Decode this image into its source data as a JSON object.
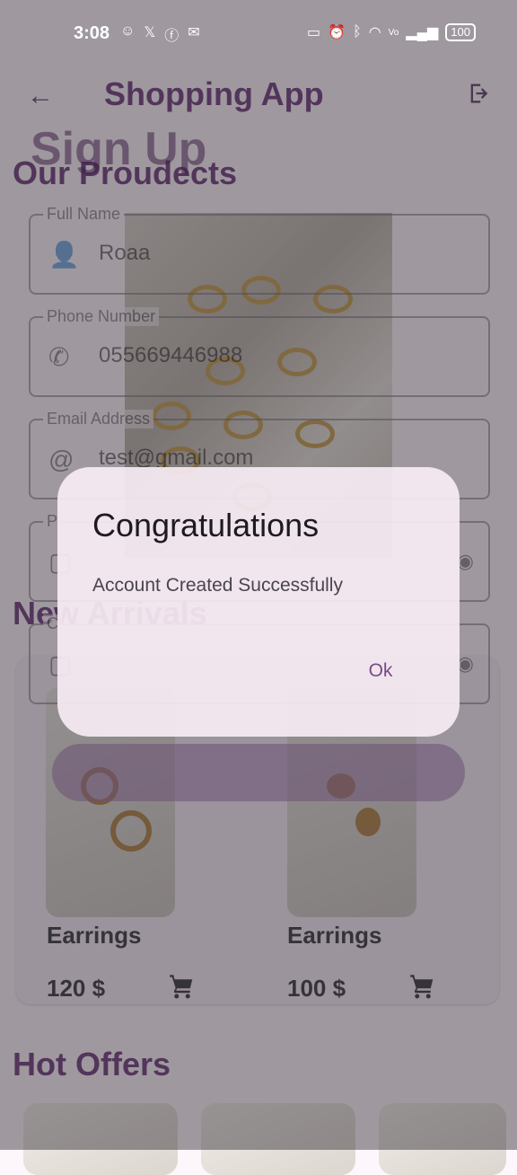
{
  "status_bar": {
    "time": "3:08",
    "battery": "100"
  },
  "app_bar": {
    "title": "Shopping App",
    "back_icon": "arrow-back-icon",
    "logout_icon": "logout-icon"
  },
  "products": {
    "section_our": "Our Proudects",
    "section_new": "New Arrivals",
    "section_hot": "Hot Offers",
    "items": [
      {
        "name": "Earrings",
        "price": "120 $"
      },
      {
        "name": "Earrings",
        "price": "100 $"
      }
    ]
  },
  "signup": {
    "title": "Sign Up",
    "fields": [
      {
        "label": "Full Name",
        "value": "Roaa",
        "icon": "person-icon"
      },
      {
        "label": "Phone Number",
        "value": "055669446988",
        "icon": "phone-icon"
      },
      {
        "label": "Email Address",
        "value": "test@gmail.com",
        "icon": "at-icon"
      },
      {
        "label": "P",
        "value": "",
        "icon": "lock-icon"
      },
      {
        "label": "C",
        "value": "",
        "icon": "lock-icon"
      }
    ]
  },
  "dialog": {
    "title": "Congratulations",
    "message": "Account Created Successfully",
    "ok_label": "Ok"
  },
  "colors": {
    "primary": "#7a4a87",
    "dialog_bg": "#f7ebf4",
    "scrim": "#1c181e"
  }
}
